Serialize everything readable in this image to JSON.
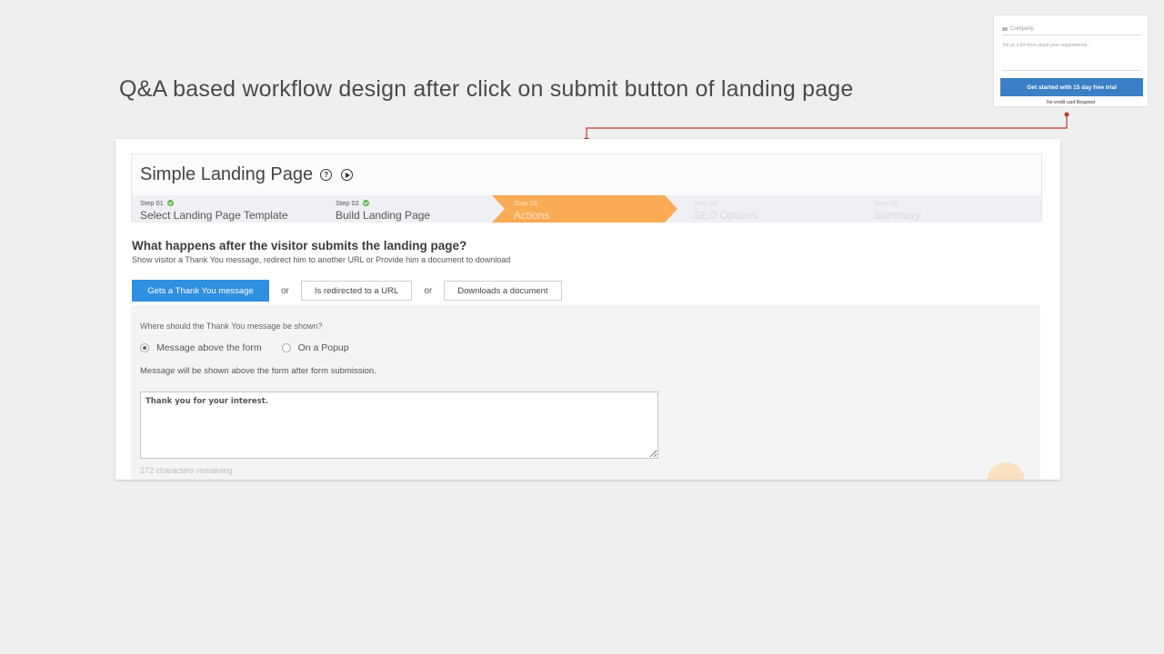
{
  "slide": {
    "title": "Q&A based workflow design after click on submit button of landing page"
  },
  "mini_form": {
    "company_placeholder": "Company",
    "requirements_placeholder": "Tell us a bit more about your requirements...",
    "cta_label": "Get started with 15 day free trial",
    "note": "No credit card Required",
    "cta_color": "#3b7fc6"
  },
  "connector": {
    "color": "#c0392b"
  },
  "landing_page": {
    "title": "Simple Landing Page",
    "help_icon": "help-circle-icon",
    "play_icon": "play-circle-icon",
    "steps": [
      {
        "num": "Step 01",
        "label": "Select Landing Page Template",
        "state": "done"
      },
      {
        "num": "Step 02",
        "label": "Build Landing Page",
        "state": "done"
      },
      {
        "num": "Step 03",
        "label": "Actions",
        "state": "active"
      },
      {
        "num": "Step 04",
        "label": "SEO Options",
        "state": "disabled"
      },
      {
        "num": "Step 05",
        "label": "Summary",
        "state": "disabled"
      }
    ],
    "question": "What happens after the visitor submits the landing page?",
    "question_sub": "Show visitor a Thank You message, redirect him to another URL or Provide him a document to download",
    "options": {
      "thank_you": "Gets a Thank You message",
      "or_1": "or",
      "redirect": "Is redirected to a URL",
      "or_2": "or",
      "download": "Downloads a document",
      "selected": "thank_you"
    },
    "thank_you_settings": {
      "where_question": "Where should the Thank You message be shown?",
      "radio_above": "Message above the form",
      "radio_popup": "On a Popup",
      "selected": "above",
      "note": "Message will be shown above the form after form submission.",
      "message": "Thank you for your interest.",
      "chars_remaining": "272 characters remaining"
    },
    "accent_active": "#fbab56",
    "primary_blue": "#2f8fe0"
  }
}
